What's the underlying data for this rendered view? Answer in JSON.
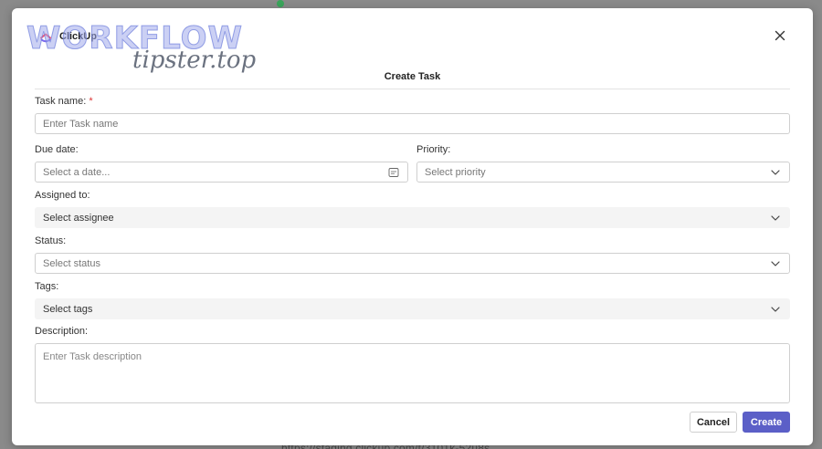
{
  "backdrop": {
    "url_text": "https://staging.clickup.com/t/3101k-52u8s"
  },
  "brand": {
    "name": "ClickUp"
  },
  "watermark": {
    "top": "WORKFLOW",
    "bottom": "tipster.top"
  },
  "modal": {
    "title": "Create Task",
    "task_name": {
      "label": "Task name:",
      "required_mark": "*",
      "placeholder": "Enter Task name"
    },
    "due_date": {
      "label": "Due date:",
      "placeholder": "Select a date..."
    },
    "priority": {
      "label": "Priority:",
      "placeholder": "Select priority"
    },
    "assigned_to": {
      "label": "Assigned to:",
      "placeholder": "Select assignee"
    },
    "status": {
      "label": "Status:",
      "placeholder": "Select status"
    },
    "tags": {
      "label": "Tags:",
      "placeholder": "Select tags"
    },
    "description": {
      "label": "Description:",
      "placeholder": "Enter Task description"
    },
    "buttons": {
      "cancel": "Cancel",
      "create": "Create"
    }
  },
  "colors": {
    "primary": "#5b5fc7",
    "required": "#dd3333"
  }
}
